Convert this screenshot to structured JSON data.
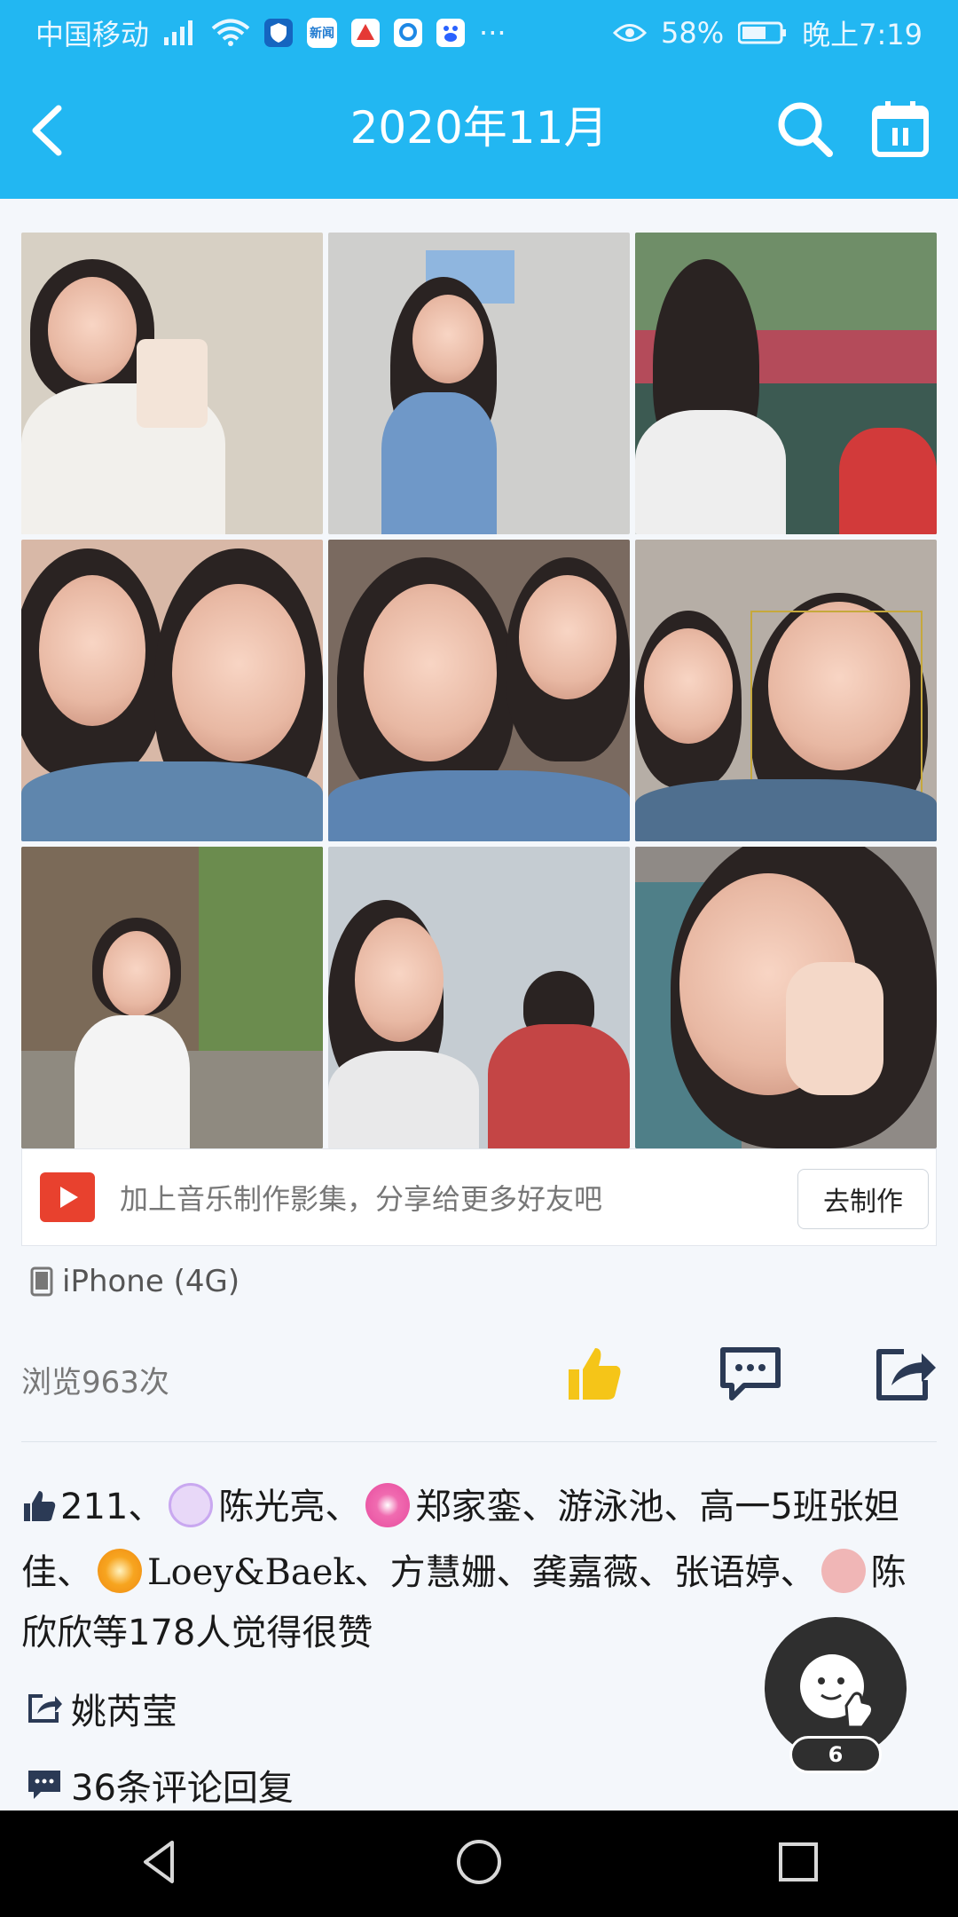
{
  "status_bar": {
    "carrier": "中国移动",
    "battery": "58%",
    "time": "晚上7:19",
    "more": "···",
    "app_badges": [
      "新闻"
    ]
  },
  "header": {
    "title": "2020年11月"
  },
  "photos": [
    {
      "id": 1,
      "bg": "#d7d0c4"
    },
    {
      "id": 2,
      "bg": "#cfcfcd"
    },
    {
      "id": 3,
      "bg": "#6f8e68"
    },
    {
      "id": 4,
      "bg": "#d8b8a7"
    },
    {
      "id": 5,
      "bg": "#7a6a60"
    },
    {
      "id": 6,
      "bg": "#b6aea6"
    },
    {
      "id": 7,
      "bg": "#7b6a58"
    },
    {
      "id": 8,
      "bg": "#c5ccd2"
    },
    {
      "id": 9,
      "bg": "#8f8a86"
    }
  ],
  "music": {
    "text": "加上音乐制作影集，分享给更多好友吧",
    "button": "去制作"
  },
  "device": "iPhone (4G)",
  "views": "浏览963次",
  "likes": {
    "count": "211",
    "sep": "、",
    "names": [
      "陈光亮",
      "郑家銮",
      "游泳池",
      "高一5班张妲佳",
      "Loey&Baek",
      "方慧姗",
      "龚嘉薇",
      "张语婷",
      "陈欣欣"
    ],
    "suffix": "等178人觉得很赞"
  },
  "share_name": "姚芮莹",
  "comments": "36条评论回复",
  "floating_badge": "6",
  "colors": {
    "header": "#22b7f2",
    "like_yellow": "#f5c518",
    "icon_dark": "#2b3a55"
  }
}
